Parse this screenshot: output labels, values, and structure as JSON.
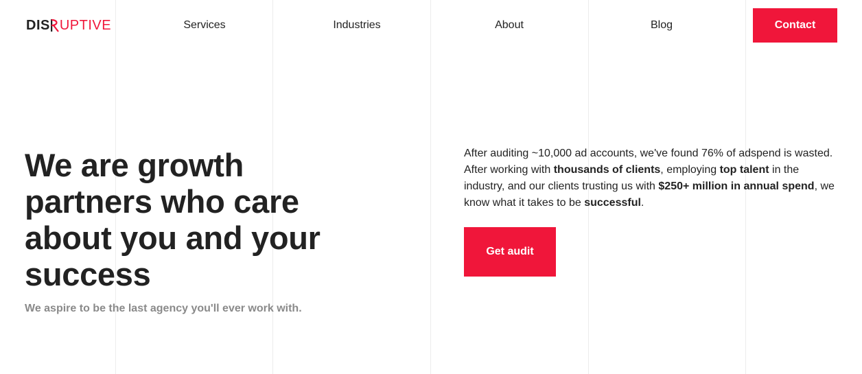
{
  "brand": {
    "logo_prefix": "DIS",
    "logo_suffix": "UPTIVE",
    "accent_color": "#f0163a"
  },
  "nav": {
    "items": [
      {
        "label": "Services"
      },
      {
        "label": "Industries"
      },
      {
        "label": "About"
      },
      {
        "label": "Blog"
      }
    ],
    "contact_label": "Contact"
  },
  "hero": {
    "title": "We are growth partners who care about you and your success",
    "subtitle": "We aspire to be the last agency you'll ever work with.",
    "body": {
      "p1": "After auditing ~10,000 ad accounts, we've found 76% of adspend is wasted. After working with ",
      "b1": "thousands of clients",
      "p2": ", employing ",
      "b2": "top talent",
      "p3": " in the industry, and our clients trusting us with ",
      "b3": "$250+ million in annual spend",
      "p4": ", we know what it takes to be ",
      "b4": "successful",
      "p5": "."
    },
    "cta_label": "Get audit"
  }
}
